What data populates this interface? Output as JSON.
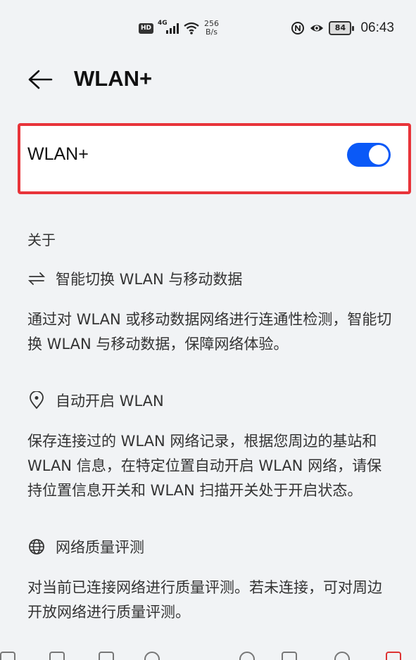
{
  "status_bar": {
    "hd": "HD",
    "network": "4G",
    "speed_value": "256",
    "speed_unit": "B/s",
    "battery": "84",
    "time": "06:43",
    "icons": [
      "signal-icon",
      "wifi-icon",
      "nfc-icon",
      "eye-comfort-icon",
      "battery-icon"
    ]
  },
  "header": {
    "title": "WLAN+",
    "back_icon": "back-arrow-icon"
  },
  "toggle_card": {
    "label": "WLAN+",
    "enabled": true,
    "accent": "#0a59f7",
    "highlight": "#e8343a"
  },
  "about": {
    "section_title": "关于",
    "features": [
      {
        "icon": "switch-arrows-icon",
        "title": "智能切换 WLAN 与移动数据",
        "description": "通过对 WLAN 或移动数据网络进行连通性检测，智能切换 WLAN 与移动数据，保障网络体验。"
      },
      {
        "icon": "location-icon",
        "title": "自动开启 WLAN",
        "description": "保存连接过的 WLAN 网络记录，根据您周边的基站和 WLAN 信息，在特定位置自动开启 WLAN 网络，请保持位置信息开关和 WLAN 扫描开关处于开启状态。"
      },
      {
        "icon": "globe-icon",
        "title": "网络质量评测",
        "description": "对当前已连接网络进行质量评测。若未连接，可对周边开放网络进行质量评测。"
      }
    ]
  }
}
